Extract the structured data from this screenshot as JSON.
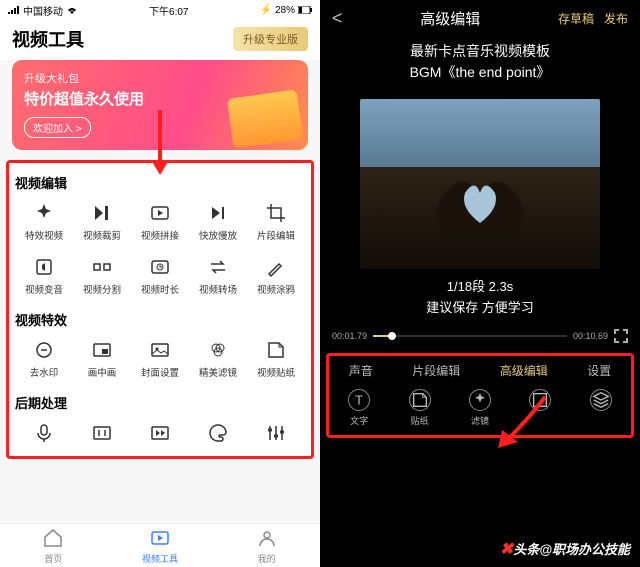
{
  "left": {
    "status": {
      "carrier": "中国移动",
      "signal_icon": "signal",
      "wifi_icon": "wifi",
      "time": "下午6:07",
      "charge_icon": "bolt",
      "battery": "28%"
    },
    "title": "视频工具",
    "pro_button": "升级专业版",
    "promo": {
      "line1": "升级大礼包",
      "line2": "特价超值永久使用",
      "cta": "欢迎加入 >"
    },
    "sections": [
      {
        "header": "视频编辑",
        "items": [
          {
            "icon": "sparkle",
            "label": "特效视频"
          },
          {
            "icon": "play-skip",
            "label": "视频裁剪"
          },
          {
            "icon": "play-box",
            "label": "视频拼接"
          },
          {
            "icon": "skip-end",
            "label": "快放慢放"
          },
          {
            "icon": "crop",
            "label": "片段编辑"
          },
          {
            "icon": "sound-box",
            "label": "视频变音"
          },
          {
            "icon": "split",
            "label": "视频分割"
          },
          {
            "icon": "clock-box",
            "label": "视频时长"
          },
          {
            "icon": "swap",
            "label": "视频转场"
          },
          {
            "icon": "brush",
            "label": "视频涂鸦"
          }
        ]
      },
      {
        "header": "视频特效",
        "items": [
          {
            "icon": "stamp",
            "label": "去水印"
          },
          {
            "icon": "pip",
            "label": "画中画"
          },
          {
            "icon": "cover",
            "label": "封面设置"
          },
          {
            "icon": "filter",
            "label": "精美滤镜"
          },
          {
            "icon": "sticker",
            "label": "视频贴纸"
          }
        ]
      },
      {
        "header": "后期处理",
        "items": [
          {
            "icon": "mic",
            "label": ""
          },
          {
            "icon": "compress",
            "label": ""
          },
          {
            "icon": "speed-box",
            "label": ""
          },
          {
            "icon": "palette",
            "label": ""
          },
          {
            "icon": "equalizer",
            "label": ""
          }
        ]
      }
    ],
    "nav": [
      {
        "icon": "home",
        "label": "首页",
        "active": false
      },
      {
        "icon": "play-outline",
        "label": "视频工具",
        "active": true
      },
      {
        "icon": "user",
        "label": "我的",
        "active": false
      }
    ]
  },
  "right": {
    "back": "<",
    "title": "高级编辑",
    "actions": {
      "draft": "存草稿",
      "publish": "发布"
    },
    "headline1": "最新卡点音乐视频模板",
    "headline2": "BGM《the end point》",
    "segment": "1/18段   2.3s",
    "advice": "建议保存   方便学习",
    "time_start": "00:01.79",
    "time_end": "00:10.69",
    "tabs": [
      {
        "label": "声音",
        "active": false
      },
      {
        "label": "片段编辑",
        "active": false
      },
      {
        "label": "高级编辑",
        "active": true
      },
      {
        "label": "设置",
        "active": false
      }
    ],
    "tools": [
      {
        "icon": "text",
        "label": "文字"
      },
      {
        "icon": "sticker",
        "label": "贴纸"
      },
      {
        "icon": "magic",
        "label": "滤镜"
      },
      {
        "icon": "frame",
        "label": ""
      },
      {
        "icon": "layers",
        "label": ""
      }
    ]
  },
  "watermark": "头条@职场办公技能"
}
